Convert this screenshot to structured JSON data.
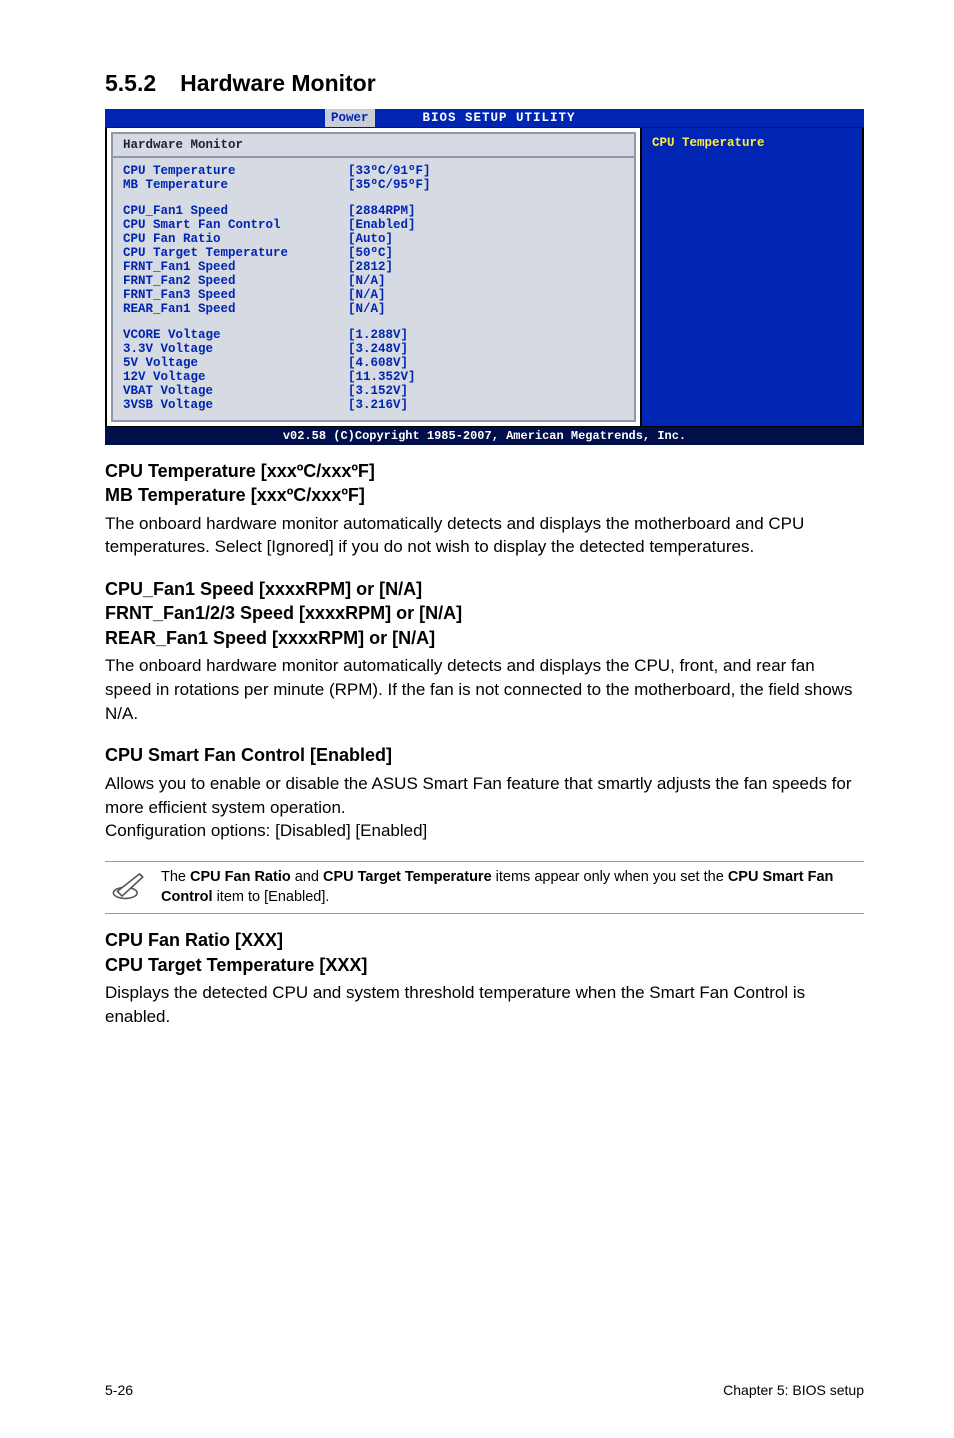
{
  "section": {
    "number": "5.5.2",
    "title": "Hardware Monitor"
  },
  "bios": {
    "tab": "Power",
    "title": "BIOS SETUP UTILITY",
    "left_header": "Hardware Monitor",
    "rows_top": [
      {
        "label": "CPU Temperature",
        "val": "[33ºC/91ºF]"
      },
      {
        "label": "MB Temperature",
        "val": "[35ºC/95ºF]"
      }
    ],
    "rows_mid": [
      {
        "label": "CPU_Fan1 Speed",
        "val": "[2884RPM]"
      },
      {
        "label": "CPU Smart Fan Control",
        "val": "[Enabled]"
      },
      {
        "label": "CPU Fan Ratio",
        "val": "[Auto]"
      },
      {
        "label": "CPU Target Temperature",
        "val": "[50ºC]"
      },
      {
        "label": "FRNT_Fan1 Speed",
        "val": "[2812]"
      },
      {
        "label": "FRNT_Fan2 Speed",
        "val": "[N/A]"
      },
      {
        "label": "FRNT_Fan3 Speed",
        "val": "[N/A]"
      },
      {
        "label": "REAR_Fan1 Speed",
        "val": "[N/A]"
      }
    ],
    "rows_volt": [
      {
        "label": "VCORE Voltage",
        "val": "[1.288V]"
      },
      {
        "label": "3.3V Voltage",
        "val": "[3.248V]"
      },
      {
        "label": "5V Voltage",
        "val": "[4.608V]"
      },
      {
        "label": "12V Voltage",
        "val": "[11.352V]"
      },
      {
        "label": "VBAT Voltage",
        "val": "[3.152V]"
      },
      {
        "label": "3VSB Voltage",
        "val": "[3.216V]"
      }
    ],
    "right": "CPU Temperature",
    "footer": "v02.58 (C)Copyright 1985-2007, American Megatrends, Inc."
  },
  "sub1": {
    "heading_line1": "CPU Temperature [xxxºC/xxxºF]",
    "heading_line2": "MB Temperature [xxxºC/xxxºF]",
    "para": "The onboard hardware monitor automatically detects and displays the motherboard and CPU temperatures. Select [Ignored] if you do not wish to display the detected temperatures."
  },
  "sub2": {
    "heading_line1": "CPU_Fan1 Speed [xxxxRPM] or [N/A]",
    "heading_line2": "FRNT_Fan1/2/3 Speed [xxxxRPM] or [N/A]",
    "heading_line3": "REAR_Fan1 Speed [xxxxRPM] or [N/A]",
    "para": "The onboard hardware monitor automatically detects and displays the CPU, front, and rear fan speed in rotations per minute (RPM). If the fan is not connected to the motherboard, the field shows N/A."
  },
  "sub3": {
    "heading": "CPU Smart Fan Control [Enabled]",
    "para": "Allows you to enable or disable the ASUS Smart Fan feature that smartly adjusts the fan speeds for more efficient system operation.\nConfiguration options: [Disabled] [Enabled]"
  },
  "note": {
    "t1": "The ",
    "b1": "CPU Fan Ratio",
    "t2": " and ",
    "b2": "CPU Target Temperature",
    "t3": " items appear only when you set the ",
    "b3": "CPU Smart Fan Control",
    "t4": " item to [Enabled]."
  },
  "sub4": {
    "heading_line1": "CPU Fan Ratio [XXX]",
    "heading_line2": "CPU Target Temperature [XXX]",
    "para": "Displays the detected CPU and system threshold temperature when the Smart Fan Control is enabled."
  },
  "footer": {
    "left": "5-26",
    "right": "Chapter 5: BIOS setup"
  }
}
